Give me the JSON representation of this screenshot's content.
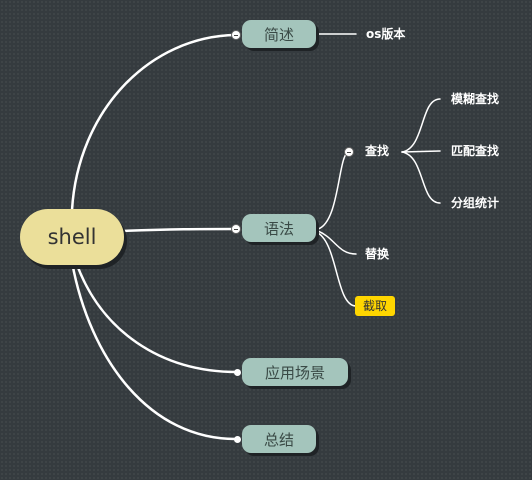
{
  "root": {
    "label": "shell"
  },
  "branches": [
    {
      "label": "简述",
      "children": [
        {
          "label": "os版本"
        }
      ]
    },
    {
      "label": "语法",
      "children": [
        {
          "label": "查找",
          "children": [
            {
              "label": "模糊查找"
            },
            {
              "label": "匹配查找"
            },
            {
              "label": "分组统计"
            }
          ]
        },
        {
          "label": "替换"
        },
        {
          "label": "截取"
        }
      ]
    },
    {
      "label": "应用场景"
    },
    {
      "label": "总结"
    }
  ],
  "colors": {
    "background": "#353b3f",
    "root_fill": "#ebdf9a",
    "branch_fill": "#a4c5bc",
    "highlight": "#ffd600",
    "line": "#ffffff"
  }
}
